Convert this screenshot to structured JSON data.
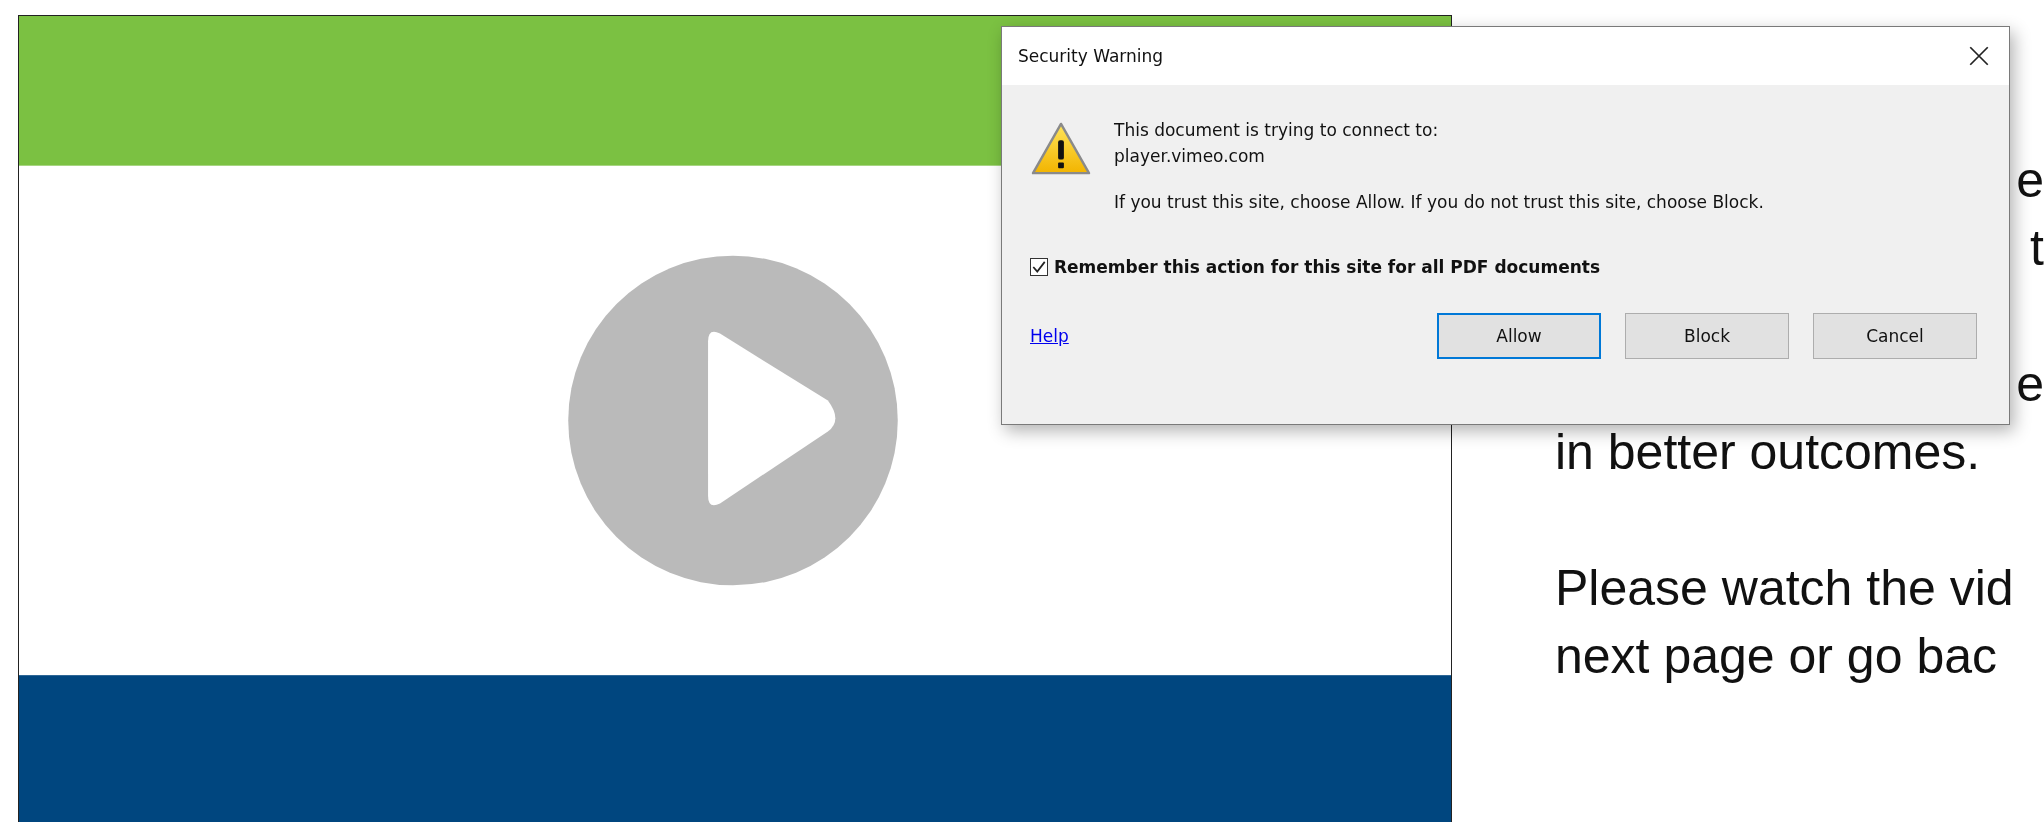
{
  "page": {
    "video": {
      "kind": "picture"
    },
    "text_line_ends": [
      "e",
      "t",
      "e"
    ],
    "paragraphs": [
      [
        "in better outcomes."
      ],
      [
        "Please watch the vid",
        "next page or go bac"
      ]
    ]
  },
  "dialog": {
    "title": "Security Warning",
    "message": [
      "This document is trying to connect to:",
      "player.vimeo.com"
    ],
    "advice": "If you trust this site, choose Allow. If you do not trust this site, choose Block.",
    "remember": {
      "label": "Remember this action for this site for all PDF documents",
      "checked": true
    },
    "help_link": "Help",
    "buttons": [
      {
        "label": "Allow",
        "selected": true
      },
      {
        "label": "Block",
        "selected": false
      },
      {
        "label": "Cancel",
        "selected": false
      }
    ]
  }
}
